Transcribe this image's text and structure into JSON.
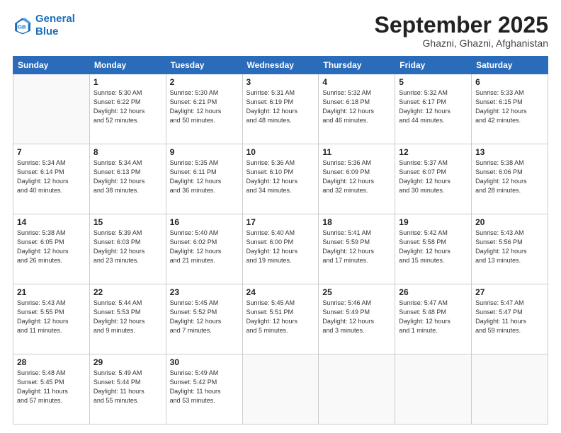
{
  "header": {
    "logo_line1": "General",
    "logo_line2": "Blue",
    "month": "September 2025",
    "location": "Ghazni, Ghazni, Afghanistan"
  },
  "weekdays": [
    "Sunday",
    "Monday",
    "Tuesday",
    "Wednesday",
    "Thursday",
    "Friday",
    "Saturday"
  ],
  "weeks": [
    [
      {
        "day": "",
        "info": ""
      },
      {
        "day": "1",
        "info": "Sunrise: 5:30 AM\nSunset: 6:22 PM\nDaylight: 12 hours\nand 52 minutes."
      },
      {
        "day": "2",
        "info": "Sunrise: 5:30 AM\nSunset: 6:21 PM\nDaylight: 12 hours\nand 50 minutes."
      },
      {
        "day": "3",
        "info": "Sunrise: 5:31 AM\nSunset: 6:19 PM\nDaylight: 12 hours\nand 48 minutes."
      },
      {
        "day": "4",
        "info": "Sunrise: 5:32 AM\nSunset: 6:18 PM\nDaylight: 12 hours\nand 46 minutes."
      },
      {
        "day": "5",
        "info": "Sunrise: 5:32 AM\nSunset: 6:17 PM\nDaylight: 12 hours\nand 44 minutes."
      },
      {
        "day": "6",
        "info": "Sunrise: 5:33 AM\nSunset: 6:15 PM\nDaylight: 12 hours\nand 42 minutes."
      }
    ],
    [
      {
        "day": "7",
        "info": "Sunrise: 5:34 AM\nSunset: 6:14 PM\nDaylight: 12 hours\nand 40 minutes."
      },
      {
        "day": "8",
        "info": "Sunrise: 5:34 AM\nSunset: 6:13 PM\nDaylight: 12 hours\nand 38 minutes."
      },
      {
        "day": "9",
        "info": "Sunrise: 5:35 AM\nSunset: 6:11 PM\nDaylight: 12 hours\nand 36 minutes."
      },
      {
        "day": "10",
        "info": "Sunrise: 5:36 AM\nSunset: 6:10 PM\nDaylight: 12 hours\nand 34 minutes."
      },
      {
        "day": "11",
        "info": "Sunrise: 5:36 AM\nSunset: 6:09 PM\nDaylight: 12 hours\nand 32 minutes."
      },
      {
        "day": "12",
        "info": "Sunrise: 5:37 AM\nSunset: 6:07 PM\nDaylight: 12 hours\nand 30 minutes."
      },
      {
        "day": "13",
        "info": "Sunrise: 5:38 AM\nSunset: 6:06 PM\nDaylight: 12 hours\nand 28 minutes."
      }
    ],
    [
      {
        "day": "14",
        "info": "Sunrise: 5:38 AM\nSunset: 6:05 PM\nDaylight: 12 hours\nand 26 minutes."
      },
      {
        "day": "15",
        "info": "Sunrise: 5:39 AM\nSunset: 6:03 PM\nDaylight: 12 hours\nand 23 minutes."
      },
      {
        "day": "16",
        "info": "Sunrise: 5:40 AM\nSunset: 6:02 PM\nDaylight: 12 hours\nand 21 minutes."
      },
      {
        "day": "17",
        "info": "Sunrise: 5:40 AM\nSunset: 6:00 PM\nDaylight: 12 hours\nand 19 minutes."
      },
      {
        "day": "18",
        "info": "Sunrise: 5:41 AM\nSunset: 5:59 PM\nDaylight: 12 hours\nand 17 minutes."
      },
      {
        "day": "19",
        "info": "Sunrise: 5:42 AM\nSunset: 5:58 PM\nDaylight: 12 hours\nand 15 minutes."
      },
      {
        "day": "20",
        "info": "Sunrise: 5:43 AM\nSunset: 5:56 PM\nDaylight: 12 hours\nand 13 minutes."
      }
    ],
    [
      {
        "day": "21",
        "info": "Sunrise: 5:43 AM\nSunset: 5:55 PM\nDaylight: 12 hours\nand 11 minutes."
      },
      {
        "day": "22",
        "info": "Sunrise: 5:44 AM\nSunset: 5:53 PM\nDaylight: 12 hours\nand 9 minutes."
      },
      {
        "day": "23",
        "info": "Sunrise: 5:45 AM\nSunset: 5:52 PM\nDaylight: 12 hours\nand 7 minutes."
      },
      {
        "day": "24",
        "info": "Sunrise: 5:45 AM\nSunset: 5:51 PM\nDaylight: 12 hours\nand 5 minutes."
      },
      {
        "day": "25",
        "info": "Sunrise: 5:46 AM\nSunset: 5:49 PM\nDaylight: 12 hours\nand 3 minutes."
      },
      {
        "day": "26",
        "info": "Sunrise: 5:47 AM\nSunset: 5:48 PM\nDaylight: 12 hours\nand 1 minute."
      },
      {
        "day": "27",
        "info": "Sunrise: 5:47 AM\nSunset: 5:47 PM\nDaylight: 11 hours\nand 59 minutes."
      }
    ],
    [
      {
        "day": "28",
        "info": "Sunrise: 5:48 AM\nSunset: 5:45 PM\nDaylight: 11 hours\nand 57 minutes."
      },
      {
        "day": "29",
        "info": "Sunrise: 5:49 AM\nSunset: 5:44 PM\nDaylight: 11 hours\nand 55 minutes."
      },
      {
        "day": "30",
        "info": "Sunrise: 5:49 AM\nSunset: 5:42 PM\nDaylight: 11 hours\nand 53 minutes."
      },
      {
        "day": "",
        "info": ""
      },
      {
        "day": "",
        "info": ""
      },
      {
        "day": "",
        "info": ""
      },
      {
        "day": "",
        "info": ""
      }
    ]
  ]
}
